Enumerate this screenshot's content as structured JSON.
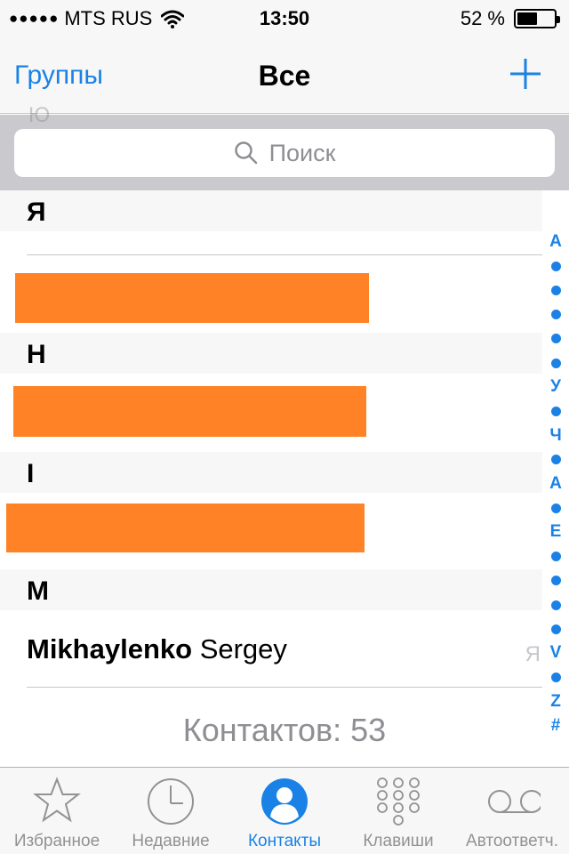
{
  "status_bar": {
    "carrier": "MTS RUS",
    "signal": "●●●●●",
    "time": "13:50",
    "battery": "52 %"
  },
  "nav": {
    "left": "Группы",
    "title": "Все"
  },
  "search": {
    "placeholder": "Поиск"
  },
  "list": {
    "ghost_letter": "Ю",
    "sections": [
      {
        "letter": "Я"
      },
      {
        "letter": "H"
      },
      {
        "letter": "I"
      },
      {
        "letter": "M"
      }
    ],
    "contact": {
      "last": "Mikhaylenko",
      "first": "Sergey",
      "hint": "Я"
    },
    "count": "Контактов: 53"
  },
  "index": [
    "А",
    "•",
    "•",
    "•",
    "•",
    "•",
    "У",
    "•",
    "Ч",
    "•",
    "A",
    "•",
    "E",
    "•",
    "•",
    "•",
    "•",
    "V",
    "•",
    "Z",
    "#"
  ],
  "tabs": [
    {
      "label": "Избранное",
      "icon": "star-icon"
    },
    {
      "label": "Недавние",
      "icon": "clock-icon"
    },
    {
      "label": "Контакты",
      "icon": "person-icon"
    },
    {
      "label": "Клавиши",
      "icon": "keypad-icon"
    },
    {
      "label": "Автоответч.",
      "icon": "voicemail-icon"
    }
  ],
  "colors": {
    "accent": "#1a82e6",
    "redaction": "#ff8326"
  }
}
